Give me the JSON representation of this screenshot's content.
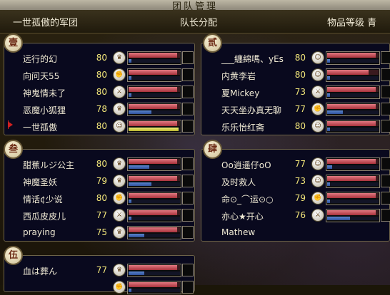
{
  "window": {
    "title": "团队管理"
  },
  "header": {
    "team_name": "一世孤傲的军团",
    "leader_assign": "队长分配",
    "loot_level": "物品等级 青"
  },
  "groups": [
    {
      "badge": "壹",
      "members": [
        {
          "name": "远行的幻",
          "level": "80",
          "cls_icon": "gold-class-icon",
          "hp": 0.95,
          "mp": 0.05,
          "mp_color": "blue"
        },
        {
          "name": "向问天55",
          "level": "80",
          "cls_icon": "fist-class-icon",
          "hp": 0.95,
          "mp": 0.05,
          "mp_color": "blue"
        },
        {
          "name": "神鬼情未了",
          "level": "80",
          "cls_icon": "blade-class-icon",
          "hp": 0.95,
          "mp": 0.05,
          "mp_color": "blue"
        },
        {
          "name": "恶魔小狐狸",
          "level": "78",
          "cls_icon": "gold-class-icon",
          "hp": 0.95,
          "mp": 0.45,
          "mp_color": "blue"
        },
        {
          "name": "一世孤傲",
          "level": "80",
          "cls_icon": "face-class-icon",
          "hp": 0.95,
          "mp": 0.97,
          "mp_color": "yellow",
          "leader": true
        }
      ]
    },
    {
      "badge": "贰",
      "members": [
        {
          "name": "___纏綿嗎、yEs",
          "level": "80",
          "cls_icon": "face-class-icon",
          "hp": 0.95,
          "mp": 0.05,
          "mp_color": "blue"
        },
        {
          "name": "内黄李岩",
          "level": "80",
          "cls_icon": "face-class-icon",
          "hp": 0.8,
          "mp": 0.05,
          "mp_color": "blue"
        },
        {
          "name": "夏Mickey",
          "level": "73",
          "cls_icon": "blade-class-icon",
          "hp": 0.95,
          "mp": 0.05,
          "mp_color": "blue"
        },
        {
          "name": "天天坐办真无聊",
          "level": "77",
          "cls_icon": "fist-class-icon",
          "hp": 0.95,
          "mp": 0.3,
          "mp_color": "blue"
        },
        {
          "name": "乐乐怡红斋",
          "level": "80",
          "cls_icon": "face-class-icon",
          "hp": 0.95,
          "mp": 0.05,
          "mp_color": "blue"
        }
      ]
    },
    {
      "badge": "叁",
      "members": [
        {
          "name": "甜蕉ルジ公主",
          "level": "80",
          "cls_icon": "gold-class-icon",
          "hp": 0.95,
          "mp": 0.4,
          "mp_color": "blue"
        },
        {
          "name": "神魔圣妖",
          "level": "79",
          "cls_icon": "gold-class-icon",
          "hp": 0.95,
          "mp": 0.45,
          "mp_color": "blue"
        },
        {
          "name": "情话¢少说",
          "level": "80",
          "cls_icon": "fist-class-icon",
          "hp": 0.95,
          "mp": 0.05,
          "mp_color": "blue"
        },
        {
          "name": "西瓜皮皮儿",
          "level": "77",
          "cls_icon": "blade-class-icon",
          "hp": 0.95,
          "mp": 0.05,
          "mp_color": "blue"
        },
        {
          "name": "praying",
          "level": "75",
          "cls_icon": "gold-class-icon",
          "hp": 0.95,
          "mp": 0.3,
          "mp_color": "blue"
        }
      ]
    },
    {
      "badge": "肆",
      "members": [
        {
          "name": "Oo逍遥仔oO",
          "level": "77",
          "cls_icon": "face-class-icon",
          "hp": 0.95,
          "mp": 0.1,
          "mp_color": "blue"
        },
        {
          "name": "及时救人",
          "level": "73",
          "cls_icon": "face-class-icon",
          "hp": 0.95,
          "mp": 0.05,
          "mp_color": "blue"
        },
        {
          "name": "命⊙_⌒运⊙○",
          "level": "79",
          "cls_icon": "fist-class-icon",
          "hp": 0.95,
          "mp": 0.05,
          "mp_color": "blue"
        },
        {
          "name": "亦心★开心",
          "level": "76",
          "cls_icon": "blade-class-icon",
          "hp": 0.95,
          "mp": 0.45,
          "mp_color": "blue"
        },
        {
          "name": "Mathew",
          "level": "",
          "cls_icon": "",
          "hp": 0.6,
          "mp": 0.05,
          "mp_color": "blue",
          "partial": true
        }
      ]
    },
    {
      "badge": "伍",
      "members": [
        {
          "name": "血は葬ん",
          "level": "77",
          "cls_icon": "gold-class-icon",
          "hp": 0.95,
          "mp": 0.3,
          "mp_color": "blue"
        },
        {
          "name": "",
          "level": "",
          "cls_icon": "fist-class-icon",
          "hp": 0.95,
          "mp": 0.05,
          "mp_color": "blue"
        }
      ]
    }
  ]
}
